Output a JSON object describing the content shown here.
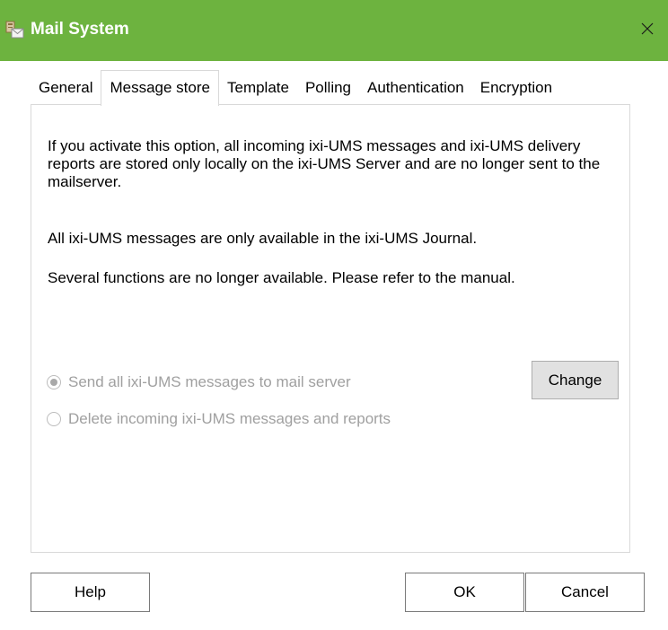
{
  "window": {
    "title": "Mail System",
    "title_icon": "mail-system-icon",
    "close_icon": "close-icon",
    "title_bar_color": "#6db33f"
  },
  "tabs": [
    {
      "label": "General",
      "active": false
    },
    {
      "label": "Message store",
      "active": true
    },
    {
      "label": "Template",
      "active": false
    },
    {
      "label": "Polling",
      "active": false
    },
    {
      "label": "Authentication",
      "active": false
    },
    {
      "label": "Encryption",
      "active": false
    }
  ],
  "panel": {
    "paragraph1": "If you activate this option, all incoming ixi-UMS messages and ixi-UMS delivery reports are stored only locally on the ixi-UMS Server and are no longer sent to the mailserver.",
    "paragraph2": "All ixi-UMS messages are only available in the ixi-UMS Journal.",
    "paragraph3": "Several functions are no longer available. Please refer to the manual.",
    "options": [
      {
        "label": "Send all ixi-UMS messages to mail server",
        "checked": true,
        "enabled": false
      },
      {
        "label": "Delete incoming ixi-UMS messages and reports",
        "checked": false,
        "enabled": false
      }
    ],
    "change_label": "Change"
  },
  "footer": {
    "help_label": "Help",
    "ok_label": "OK",
    "cancel_label": "Cancel"
  }
}
